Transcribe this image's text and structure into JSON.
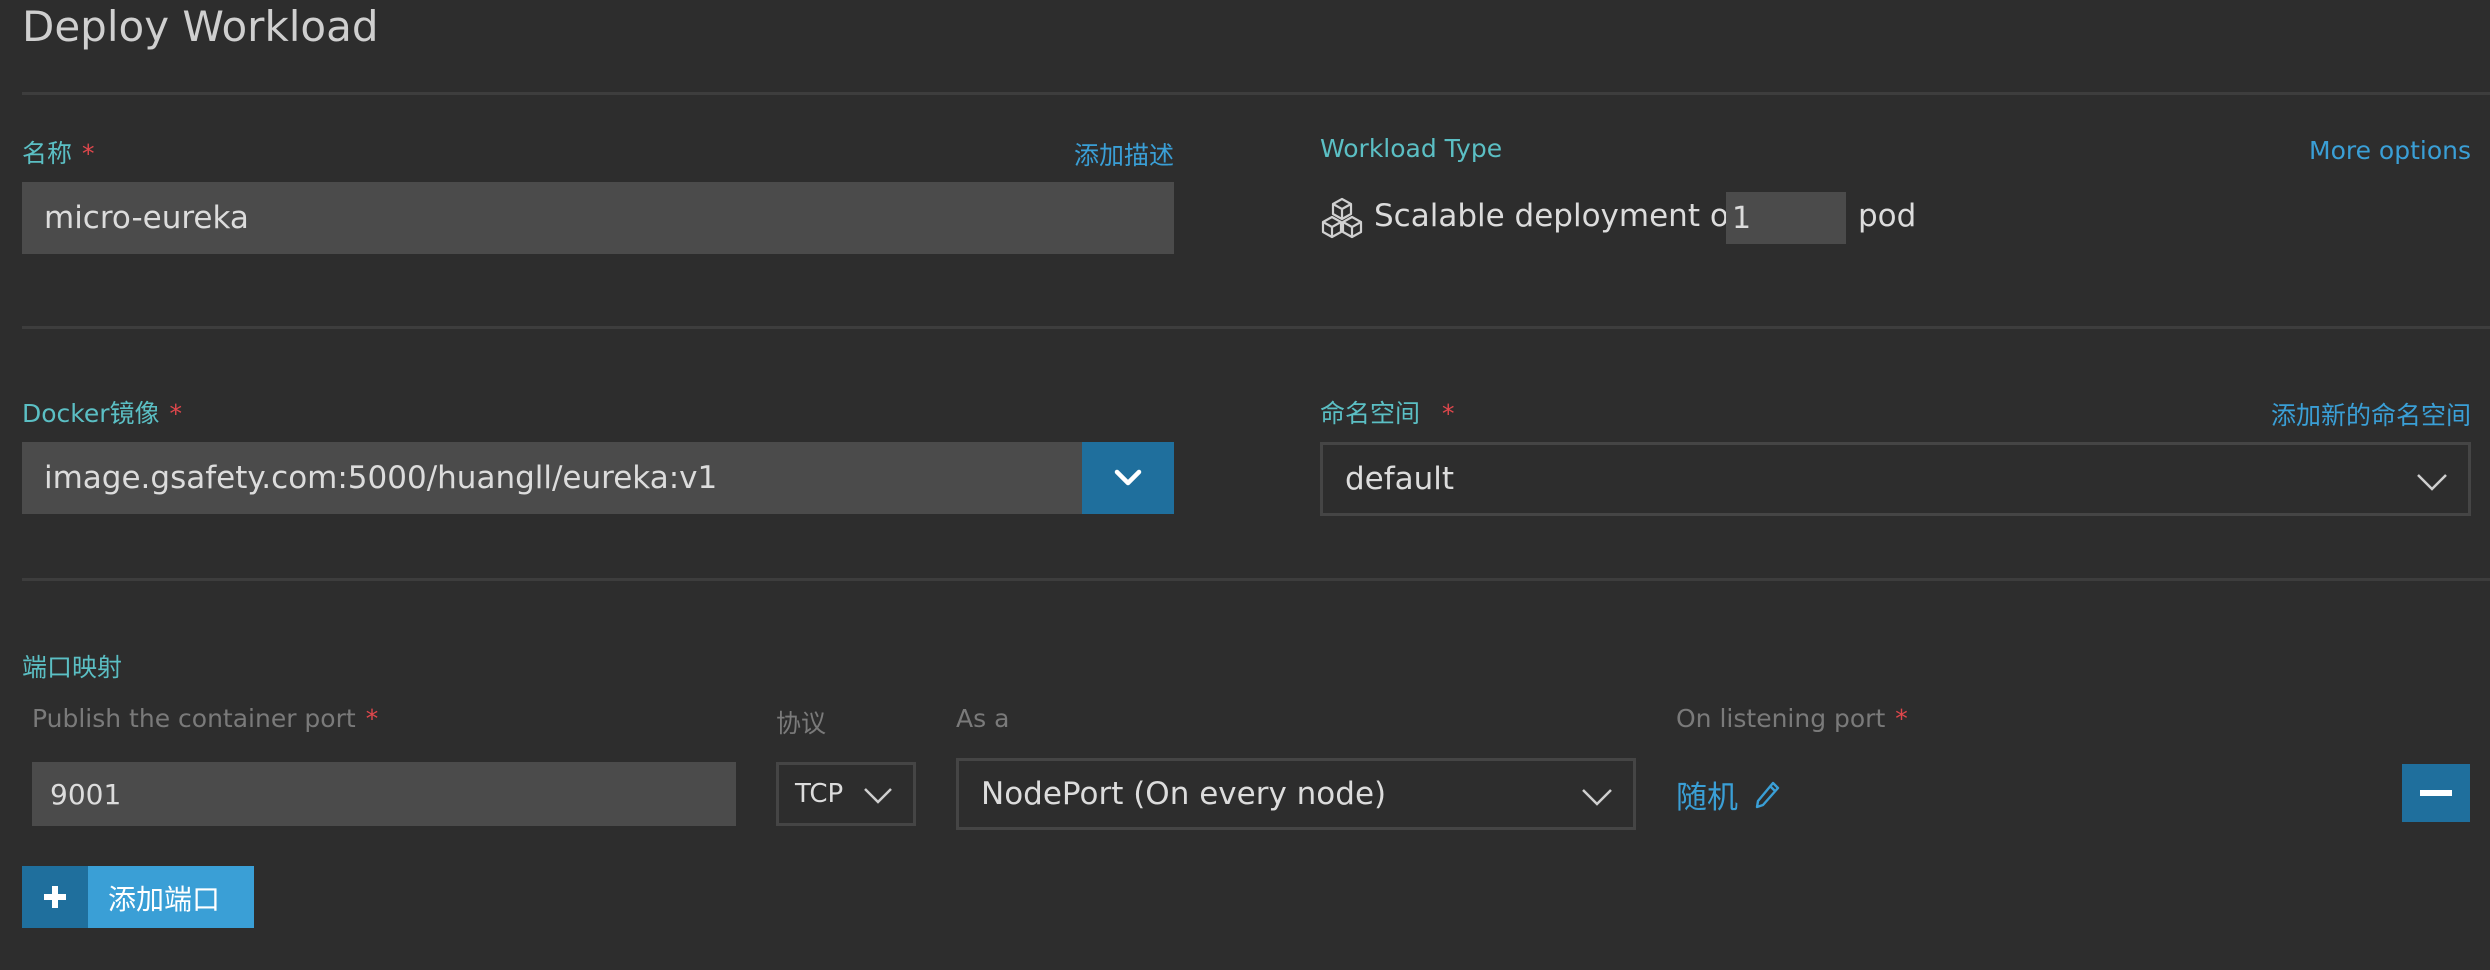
{
  "page": {
    "title": "Deploy Workload"
  },
  "name_field": {
    "label": "名称",
    "required_mark": "*",
    "add_description": "添加描述",
    "value": "micro-eureka"
  },
  "workload_type": {
    "label": "Workload Type",
    "more_options": "More options",
    "prefix": "Scalable deployment of",
    "pods": "1",
    "suffix": "pod"
  },
  "docker_image": {
    "label": "Docker镜像",
    "required_mark": "*",
    "value": "image.gsafety.com:5000/huangll/eureka:v1"
  },
  "namespace": {
    "label": "命名空间",
    "required_mark": "*",
    "add_new": "添加新的命名空间",
    "value": "default"
  },
  "port_mapping": {
    "section_label": "端口映射",
    "col_container_port": "Publish the container port",
    "col_protocol": "协议",
    "col_as_a": "As a",
    "col_listening_port": "On listening port",
    "required_mark": "*",
    "row": {
      "container_port": "9001",
      "protocol": "TCP",
      "service_type": "NodePort (On every node)",
      "listening_port": "随机"
    },
    "add_port": "添加端口"
  },
  "colors": {
    "accent": "#1f6f9d",
    "label": "#5bbfc4",
    "link": "#3a9fd6",
    "required": "#e0474c"
  }
}
